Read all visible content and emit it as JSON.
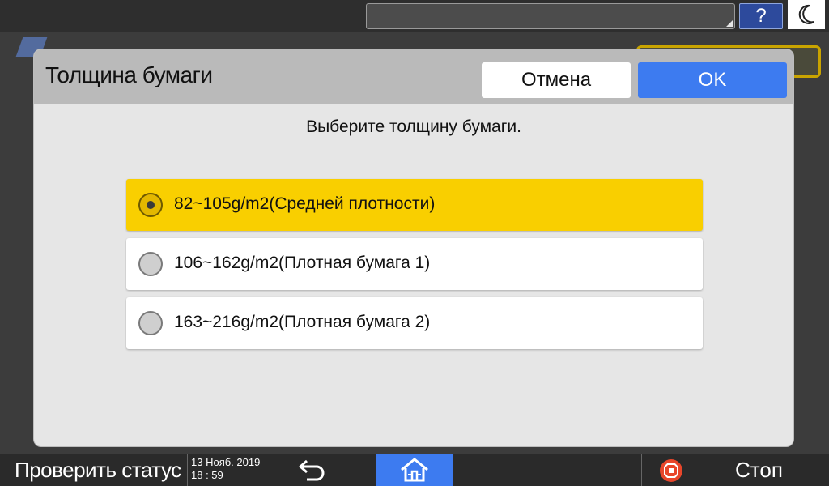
{
  "topbar": {
    "help_label": "?"
  },
  "dialog": {
    "title": "Толщина бумаги",
    "cancel_label": "Отмена",
    "ok_label": "OK",
    "prompt": "Выберите толщину бумаги.",
    "options": [
      {
        "label": "82~105g/m2(Средней плотности)",
        "selected": true
      },
      {
        "label": "106~162g/m2(Плотная бумага 1)",
        "selected": false
      },
      {
        "label": "163~216g/m2(Плотная бумага 2)",
        "selected": false
      }
    ]
  },
  "bottombar": {
    "status_label": "Проверить статус",
    "date": "13 Нояб. 2019",
    "time": "18 : 59",
    "stop_label": "Стоп",
    "icons": [
      "back-arrow-icon",
      "home-icon",
      "stop-icon"
    ]
  },
  "colors": {
    "selected_option": "#f9cf00",
    "ok_button": "#3d7bf0",
    "help_button": "#2d4a9c"
  }
}
